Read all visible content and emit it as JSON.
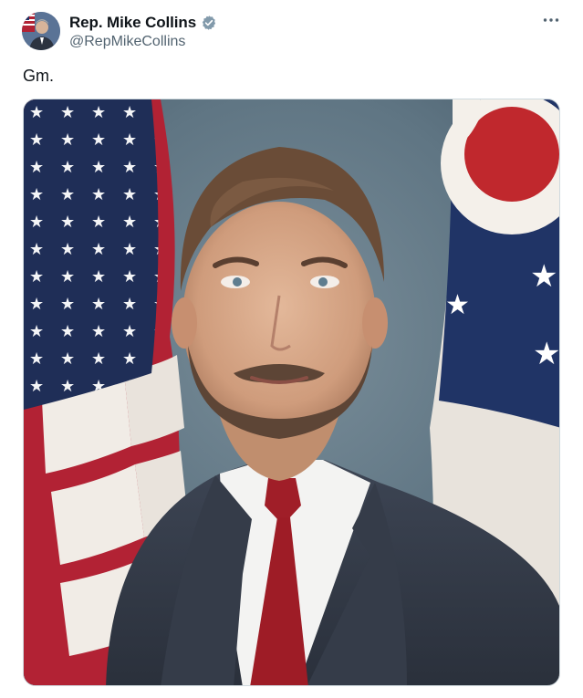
{
  "tweet": {
    "author": {
      "display_name": "Rep. Mike Collins",
      "handle": "@RepMikeCollins",
      "verified": true,
      "verified_color": "#829aab",
      "avatar_icon": "profile-avatar"
    },
    "more_icon": "more-options-icon",
    "text": "Gm.",
    "media": {
      "type": "image",
      "description_icon": "portrait-photo",
      "colors": {
        "background": "#5d7589",
        "us_flag_blue": "#1f2e57",
        "us_flag_red": "#b22234",
        "ohio_flag_red": "#c0282d",
        "suit": "#3a4250",
        "tie": "#9e1c26"
      }
    }
  }
}
